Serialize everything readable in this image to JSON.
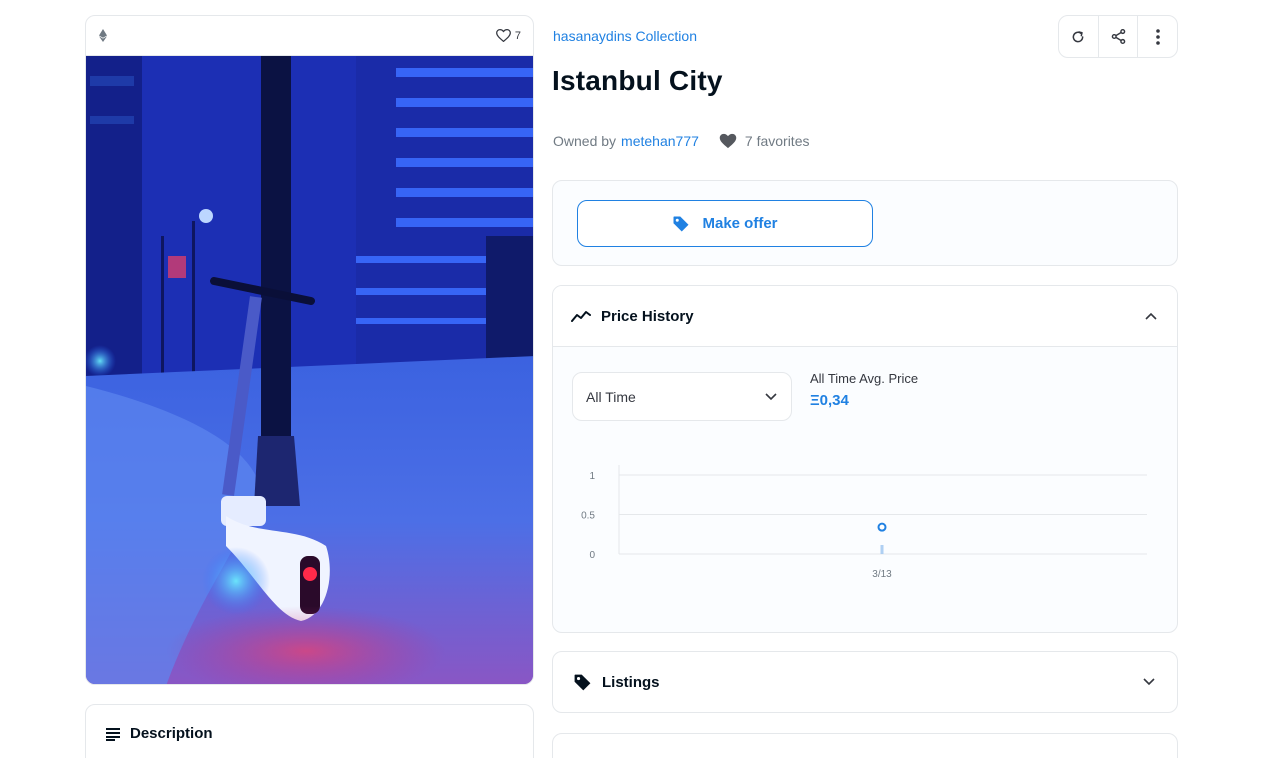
{
  "asset": {
    "favorite_count": "7"
  },
  "description": {
    "title": "Description"
  },
  "header": {
    "collection_name": "hasanaydins Collection",
    "title": "Istanbul City",
    "owned_by_label": "Owned by",
    "owner_name": "metehan777",
    "favorites_text": "7 favorites",
    "actions": [
      {
        "name": "refresh-button",
        "icon": "refresh-icon"
      },
      {
        "name": "share-button",
        "icon": "share-icon"
      },
      {
        "name": "more-options-button",
        "icon": "more-vertical-icon"
      }
    ]
  },
  "offer": {
    "button_label": "Make offer"
  },
  "price_history": {
    "title": "Price History",
    "filter_selected": "All Time",
    "avg_label": "All Time Avg. Price",
    "avg_value": "Ξ0,34"
  },
  "chart_data": {
    "type": "scatter",
    "x": [
      "3/13"
    ],
    "series": [
      {
        "values": [
          0.34
        ]
      }
    ],
    "y_ticks": [
      "1",
      "0.5",
      "0"
    ],
    "ylim": [
      0,
      1
    ],
    "grid": true
  },
  "listings": {
    "title": "Listings"
  },
  "colors": {
    "accent": "#2081e2",
    "text_primary": "#04111d",
    "text_secondary": "#707a83",
    "border": "#e5e8eb"
  }
}
